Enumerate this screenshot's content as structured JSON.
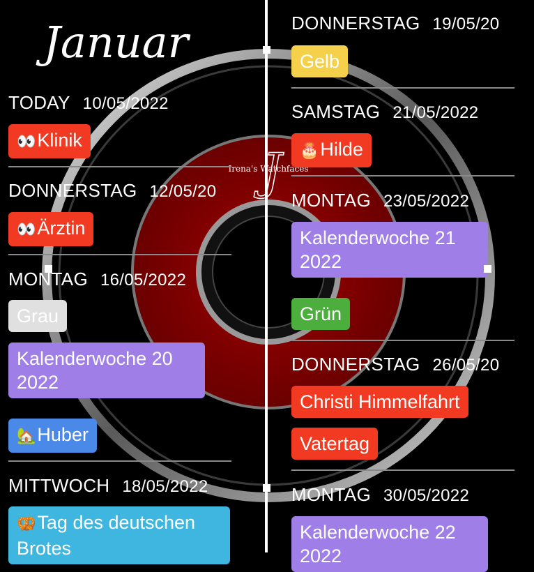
{
  "month_title": "Januar",
  "watchface_logo": "Irena's Watchfaces",
  "colors": {
    "red": "#f23a22",
    "purple": "#9f7ee8",
    "yellow": "#f5d14b",
    "grey": "#e0e0e0",
    "green": "#4caf3d",
    "blue": "#4b89e8",
    "cyan": "#3fb6e0",
    "ring_red": "#8b0000"
  },
  "left": {
    "days": [
      {
        "label": "TODAY",
        "date": "10/05/2022",
        "events": [
          {
            "icon": "eyes-icon",
            "glyph": "👀",
            "text": "Klinik",
            "color": "red"
          }
        ]
      },
      {
        "label": "DONNERSTAG",
        "date": "12/05/20",
        "events": [
          {
            "icon": "eyes-icon",
            "glyph": "👀",
            "text": "Ärztin",
            "color": "red"
          }
        ]
      },
      {
        "label": "MONTAG",
        "date": "16/05/2022",
        "events": [
          {
            "text": "Grau",
            "color": "grey"
          },
          {
            "text": "Kalenderwoche 20 2022",
            "color": "purple"
          },
          {
            "icon": "house-tree-icon",
            "glyph": "🏡",
            "text": "Huber",
            "color": "blue"
          }
        ]
      },
      {
        "label": "MITTWOCH",
        "date": "18/05/2022",
        "events": [
          {
            "icon": "pretzel-icon",
            "glyph": "🥨",
            "text": "Tag des deutschen Brotes",
            "color": "cyan"
          }
        ]
      }
    ]
  },
  "right": {
    "days": [
      {
        "label": "DONNERSTAG",
        "date": "19/05/20",
        "events": [
          {
            "text": "Gelb",
            "color": "yellow"
          }
        ]
      },
      {
        "label": "SAMSTAG",
        "date": "21/05/2022",
        "events": [
          {
            "icon": "birthday-cake-icon",
            "glyph": "🎂",
            "text": "Hilde",
            "color": "red"
          }
        ]
      },
      {
        "label": "MONTAG",
        "date": "23/05/2022",
        "events": [
          {
            "text": "Kalenderwoche 21 2022",
            "color": "purple"
          },
          {
            "text": "Grün",
            "color": "green"
          }
        ]
      },
      {
        "label": "DONNERSTAG",
        "date": "26/05/20",
        "events": [
          {
            "text": "Christi Himmelfahrt",
            "color": "red"
          },
          {
            "text": "Vatertag",
            "color": "red"
          }
        ]
      },
      {
        "label": "MONTAG",
        "date": "30/05/2022",
        "events": [
          {
            "text": "Kalenderwoche 22 2022",
            "color": "purple"
          }
        ]
      }
    ]
  }
}
